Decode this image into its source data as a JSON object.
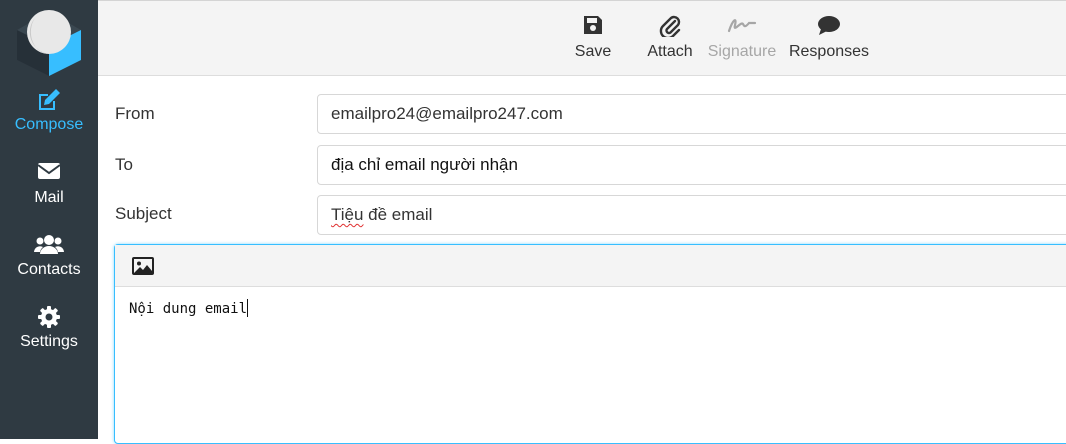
{
  "sidebar": {
    "items": [
      {
        "label": "Compose",
        "icon": "compose-icon",
        "active": true
      },
      {
        "label": "Mail",
        "icon": "envelope-icon"
      },
      {
        "label": "Contacts",
        "icon": "users-icon"
      },
      {
        "label": "Settings",
        "icon": "gear-icon"
      }
    ]
  },
  "toolbar": {
    "save_label": "Save",
    "attach_label": "Attach",
    "signature_label": "Signature",
    "responses_label": "Responses"
  },
  "form": {
    "from_label": "From",
    "from_value": "emailpro24@emailpro247.com",
    "to_label": "To",
    "to_value": "địa chỉ email người nhận",
    "subject_label": "Subject",
    "subject_word1": "Tiệu",
    "subject_rest": " đề email"
  },
  "editor": {
    "body_text": "Nội dung email"
  },
  "colors": {
    "sidebar_bg": "#2f3a42",
    "accent": "#37beff",
    "toolbar_bg": "#f4f4f4",
    "disabled_text": "#a6a6a6"
  }
}
